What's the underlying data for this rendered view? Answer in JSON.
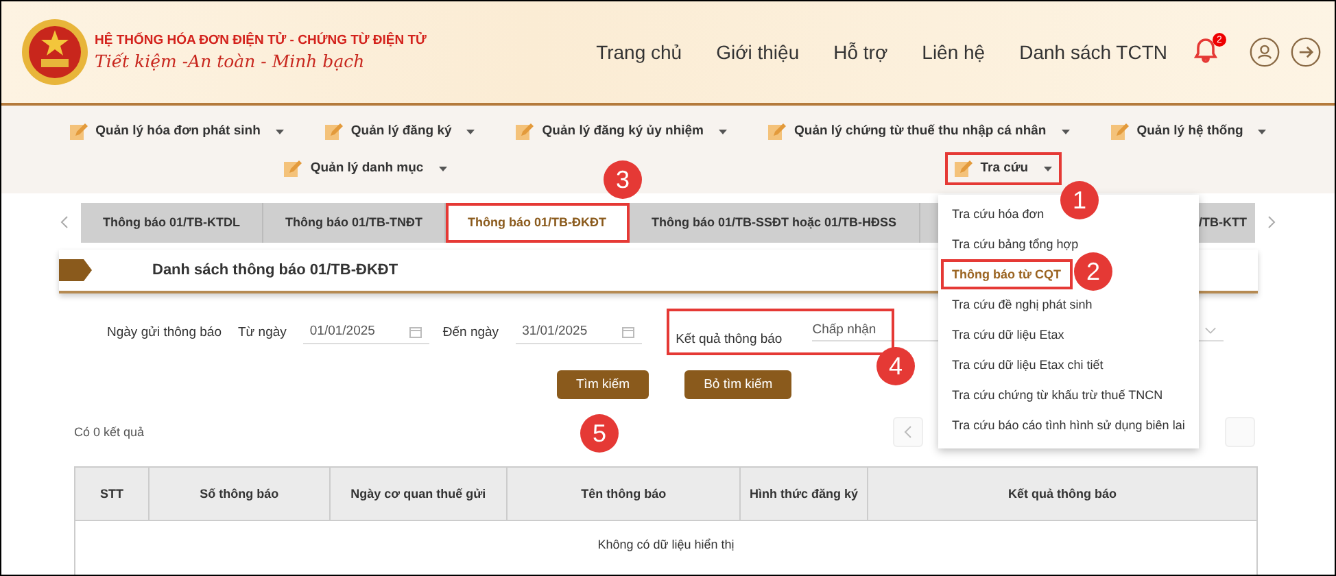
{
  "header": {
    "title": "HỆ THỐNG HÓA ĐƠN ĐIỆN TỬ - CHỨNG TỪ ĐIỆN TỬ",
    "slogan": "Tiết kiệm -An toàn - Minh bạch",
    "nav": [
      "Trang chủ",
      "Giới thiệu",
      "Hỗ trợ",
      "Liên hệ",
      "Danh sách TCTN"
    ],
    "notification_count": "2"
  },
  "menu": {
    "items": [
      {
        "label": "Quản lý hóa đơn phát sinh",
        "highlighted": false
      },
      {
        "label": "Quản lý đăng ký",
        "highlighted": false
      },
      {
        "label": "Quản lý đăng ký ủy nhiệm",
        "highlighted": false
      },
      {
        "label": "Quản lý chứng từ thuế thu nhập cá nhân",
        "highlighted": false
      },
      {
        "label": "Quản lý hệ thống",
        "highlighted": false
      },
      {
        "label": "Quản lý danh mục",
        "highlighted": false
      },
      {
        "label": "Tra cứu",
        "highlighted": true
      }
    ]
  },
  "tabs": [
    {
      "label": "Thông báo 01/TB-KTDL",
      "selected": false,
      "highlighted": false
    },
    {
      "label": "Thông báo 01/TB-TNĐT",
      "selected": false,
      "highlighted": false
    },
    {
      "label": "Thông báo 01/TB-ĐKĐT",
      "selected": true,
      "highlighted": true
    },
    {
      "label": "Thông báo 01/TB-SSĐT hoặc 01/TB-HĐSS",
      "selected": false,
      "highlighted": false
    },
    {
      "label": "/TB-KTT",
      "selected": false,
      "highlighted": false
    }
  ],
  "section_title": "Danh sách thông báo 01/TB-ĐKĐT",
  "filters": {
    "date_label": "Ngày gửi thông báo",
    "from_label": "Từ ngày",
    "from_value": "01/01/2025",
    "to_label": "Đến ngày",
    "to_value": "31/01/2025",
    "result_label": "Kết quả thông báo",
    "result_value": "Chấp nhận",
    "result_highlighted": true
  },
  "buttons": [
    "Tìm kiếm",
    "Bỏ tìm kiếm"
  ],
  "result_count": "Có 0 kết quả",
  "table": {
    "columns": [
      "STT",
      "Số thông báo",
      "Ngày cơ quan thuế gửi",
      "Tên thông báo",
      "Hình thức đăng ký",
      "Kết quả thông báo"
    ],
    "empty_message": "Không có dữ liệu hiển thị"
  },
  "dropdown": {
    "items": [
      {
        "label": "Tra cứu hóa đơn",
        "selected": false,
        "highlighted": false
      },
      {
        "label": "Tra cứu bảng tổng hợp",
        "selected": false,
        "highlighted": false
      },
      {
        "label": "Thông báo từ CQT",
        "selected": true,
        "highlighted": true
      },
      {
        "label": "Tra cứu đề nghị phát sinh",
        "selected": false,
        "highlighted": false
      },
      {
        "label": "Tra cứu dữ liệu Etax",
        "selected": false,
        "highlighted": false
      },
      {
        "label": "Tra cứu dữ liệu Etax chi tiết",
        "selected": false,
        "highlighted": false
      },
      {
        "label": "Tra cứu chứng từ khấu trừ thuế TNCN",
        "selected": false,
        "highlighted": false
      },
      {
        "label": "Tra cứu báo cáo tình hình sử dụng biên lai",
        "selected": false,
        "highlighted": false
      }
    ]
  },
  "annotations": [
    "1",
    "2",
    "3",
    "4",
    "5"
  ]
}
